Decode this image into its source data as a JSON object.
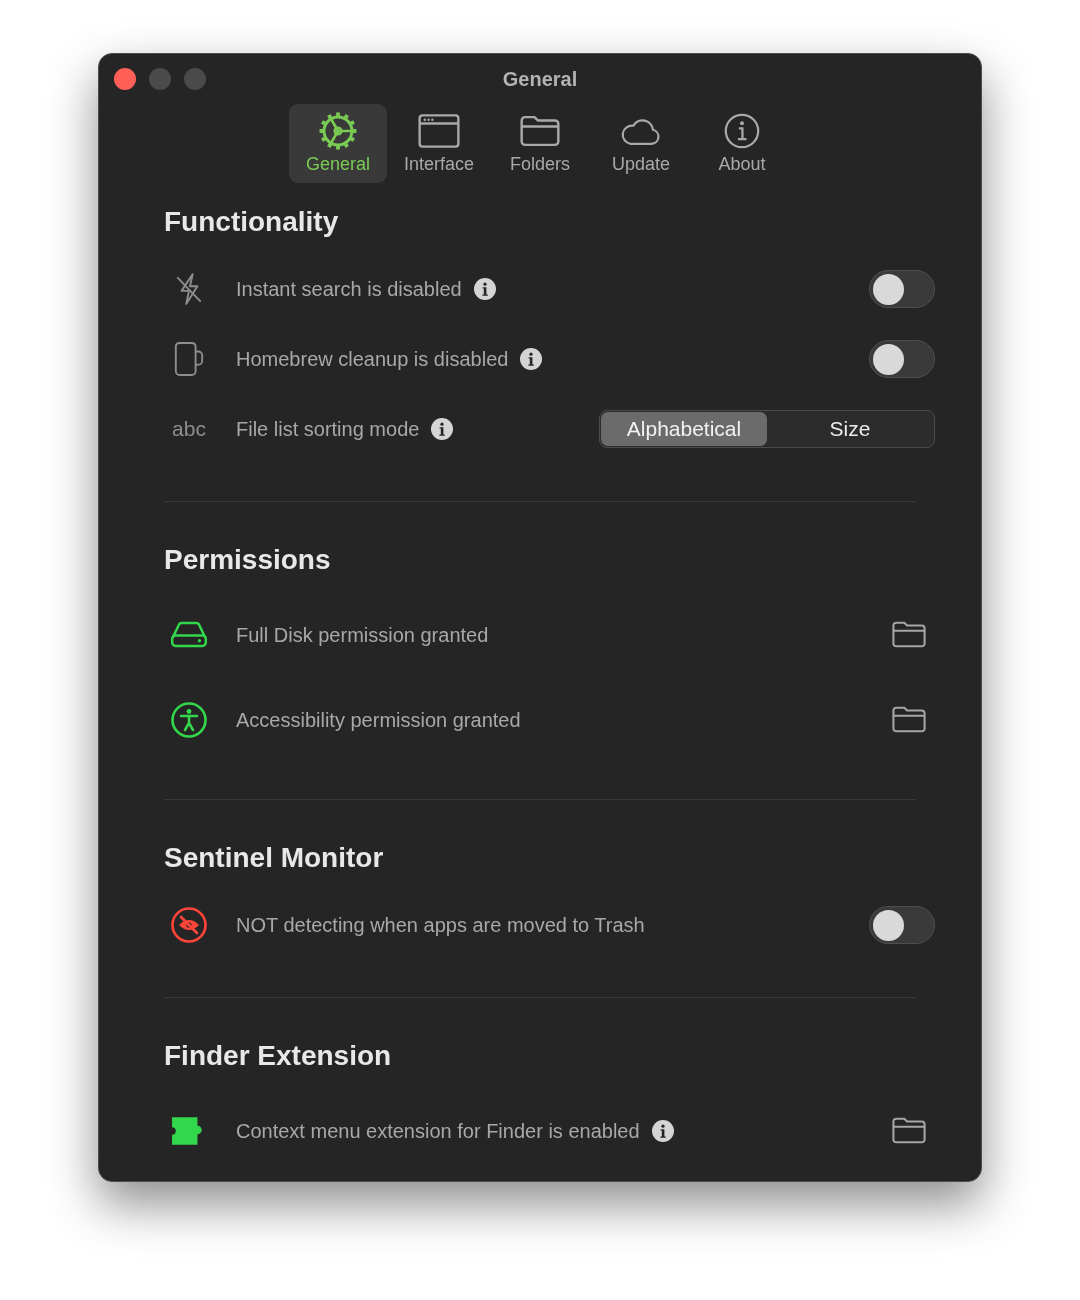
{
  "window": {
    "title": "General",
    "controls": [
      {
        "disabled": false
      },
      {
        "disabled": true
      },
      {
        "disabled": true
      }
    ]
  },
  "tabs": [
    {
      "label": "General",
      "selected": true
    },
    {
      "label": "Interface",
      "selected": false
    },
    {
      "label": "Folders",
      "selected": false
    },
    {
      "label": "Update",
      "selected": false
    },
    {
      "label": "About",
      "selected": false
    }
  ],
  "sections": [
    {
      "title": "Functionality",
      "rows": [
        {
          "kind": "toggle",
          "color": "#8e8e8e",
          "label": "Instant search is disabled",
          "info": true,
          "on": false
        },
        {
          "kind": "toggle",
          "color": "#8e8e8e",
          "label": "Homebrew cleanup is disabled",
          "info": true,
          "on": false
        },
        {
          "kind": "segmented",
          "symbol": "abc",
          "color": "#8e8e8e",
          "label": "File list sorting mode",
          "info": true,
          "options": [
            {
              "label": "Alphabetical",
              "selected": true
            },
            {
              "label": "Size",
              "selected": false
            }
          ]
        }
      ]
    },
    {
      "title": "Permissions",
      "rows": [
        {
          "kind": "folder",
          "color": "#32d74b",
          "label": "Full Disk permission granted"
        },
        {
          "kind": "folder",
          "color": "#32d74b",
          "label": "Accessibility permission granted"
        }
      ]
    },
    {
      "title": "Sentinel Monitor",
      "rows": [
        {
          "kind": "toggle",
          "color": "#ff453a",
          "label": "NOT detecting when apps are moved to Trash",
          "on": false
        }
      ]
    },
    {
      "title": "Finder Extension",
      "rows": [
        {
          "kind": "folder",
          "color": "#32d74b",
          "label": "Context menu extension for Finder is enabled",
          "info": true
        }
      ]
    }
  ]
}
